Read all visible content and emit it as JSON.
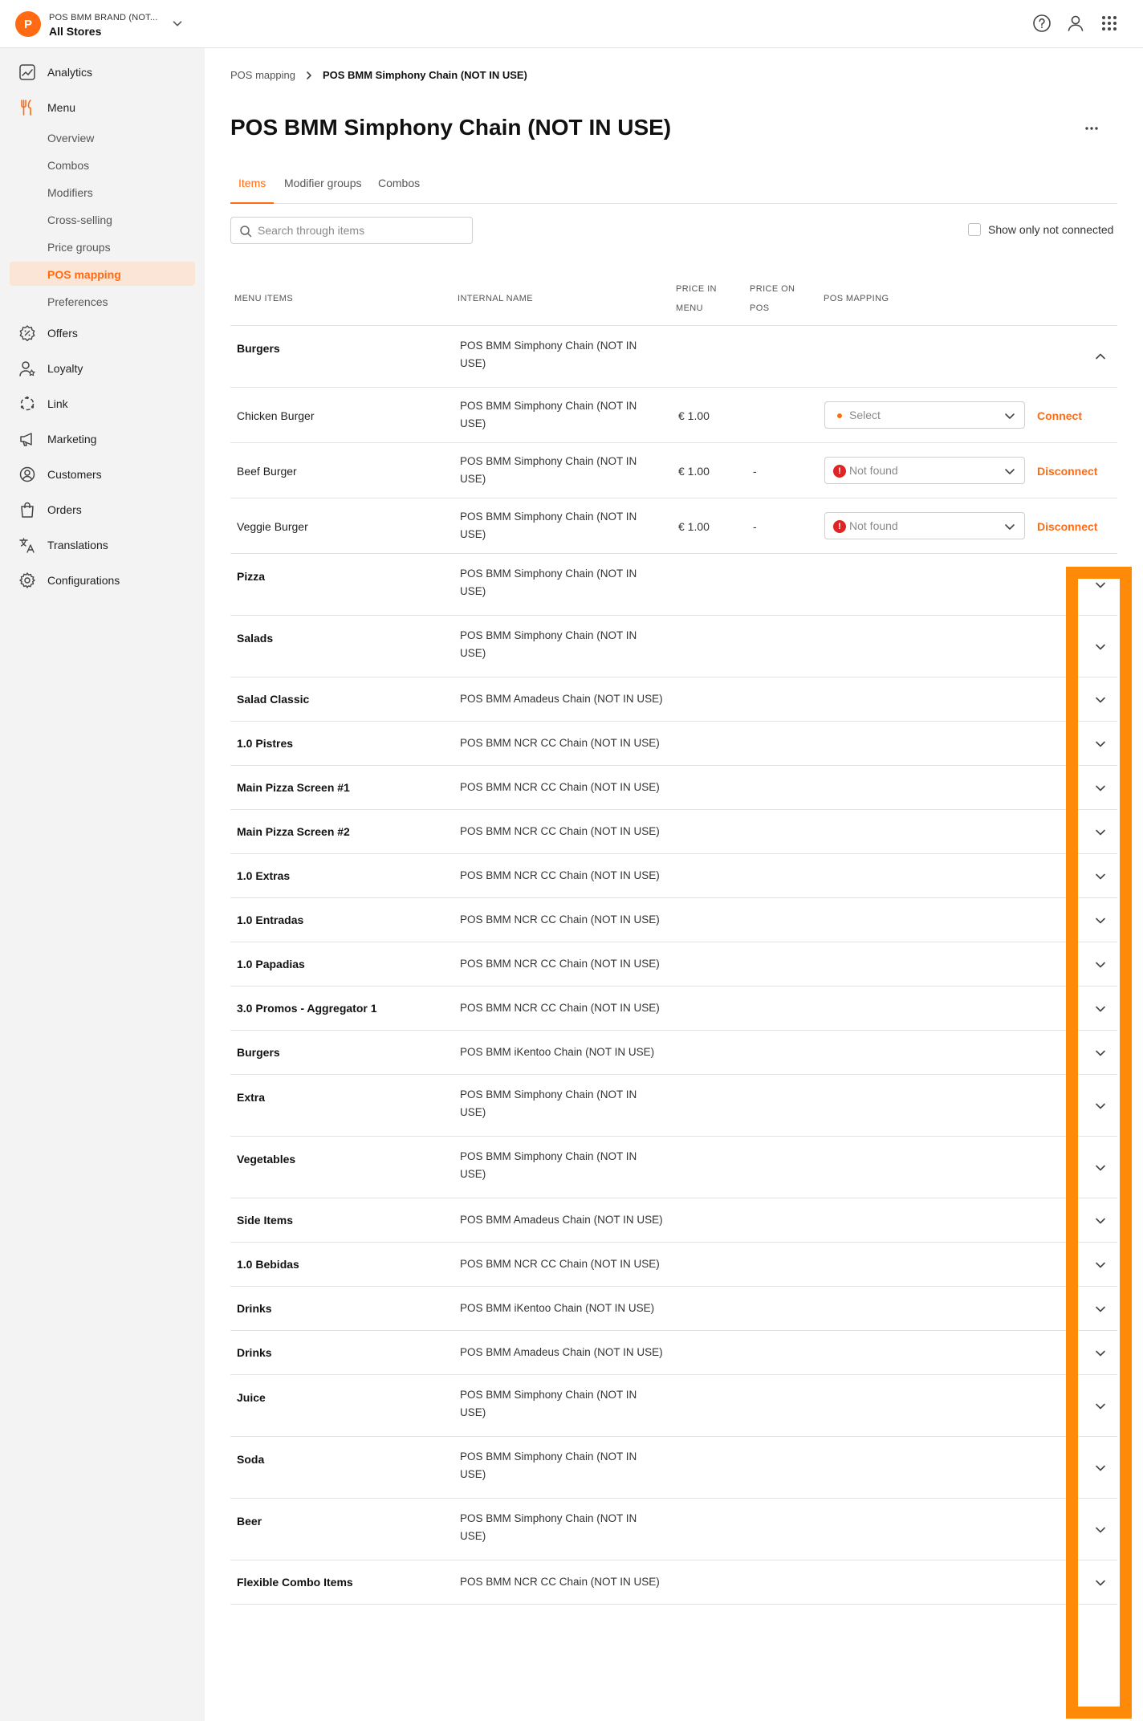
{
  "header": {
    "brand_initial": "P",
    "brand_name": "POS BMM BRAND (NOT...",
    "store": "All Stores"
  },
  "sidebar": {
    "items": [
      {
        "label": "Analytics",
        "icon": "analytics-icon"
      },
      {
        "label": "Menu",
        "icon": "menu-fork-icon"
      },
      {
        "label": "Offers",
        "icon": "offers-icon"
      },
      {
        "label": "Loyalty",
        "icon": "loyalty-icon"
      },
      {
        "label": "Link",
        "icon": "link-icon"
      },
      {
        "label": "Marketing",
        "icon": "megaphone-icon"
      },
      {
        "label": "Customers",
        "icon": "customers-icon"
      },
      {
        "label": "Orders",
        "icon": "bag-icon"
      },
      {
        "label": "Translations",
        "icon": "translate-icon"
      },
      {
        "label": "Configurations",
        "icon": "gear-icon"
      }
    ],
    "menu_subitems": [
      "Overview",
      "Combos",
      "Modifiers",
      "Cross-selling",
      "Price groups",
      "POS mapping",
      "Preferences"
    ],
    "active_subitem": "POS mapping"
  },
  "breadcrumb": {
    "parent": "POS mapping",
    "current": "POS BMM Simphony Chain (NOT IN USE)"
  },
  "page": {
    "title": "POS BMM Simphony Chain (NOT IN USE)"
  },
  "tabs": [
    "Items",
    "Modifier groups",
    "Combos"
  ],
  "active_tab": "Items",
  "search": {
    "placeholder": "Search through items",
    "value": ""
  },
  "filter": {
    "label": "Show only not connected",
    "checked": false
  },
  "table": {
    "headers": {
      "menu_items": "MENU ITEMS",
      "internal_name": "INTERNAL NAME",
      "price_in_menu_1": "PRICE IN",
      "price_in_menu_2": "MENU",
      "price_on_pos_1": "PRICE ON",
      "price_on_pos_2": "POS",
      "pos_mapping": "POS MAPPING"
    },
    "expanded_group": {
      "name": "Burgers",
      "internal": "POS BMM Simphony Chain (NOT IN USE)",
      "items": [
        {
          "name": "Chicken Burger",
          "internal": "POS BMM Simphony Chain (NOT IN USE)",
          "price_menu": "€ 1.00",
          "price_pos": "-",
          "mapping": "Select",
          "mapping_state": "select",
          "action": "Connect"
        },
        {
          "name": "Beef Burger",
          "internal": "POS BMM Simphony Chain (NOT IN USE)",
          "price_menu": "€ 1.00",
          "price_pos": "-",
          "mapping": "Not found",
          "mapping_state": "not-found",
          "action": "Disconnect"
        },
        {
          "name": "Veggie Burger",
          "internal": "POS BMM Simphony Chain (NOT IN USE)",
          "price_menu": "€ 1.00",
          "price_pos": "-",
          "mapping": "Not found",
          "mapping_state": "not-found",
          "action": "Disconnect"
        }
      ]
    },
    "groups": [
      {
        "name": "Pizza",
        "internal": "POS BMM Simphony Chain (NOT IN USE)"
      },
      {
        "name": "Salads",
        "internal": "POS BMM Simphony Chain (NOT IN USE)"
      },
      {
        "name": "Salad Classic",
        "internal": "POS BMM Amadeus Chain (NOT IN USE)"
      },
      {
        "name": "1.0 Pistres",
        "internal": "POS BMM NCR CC Chain (NOT IN USE)"
      },
      {
        "name": "Main Pizza Screen #1",
        "internal": "POS BMM NCR CC Chain (NOT IN USE)"
      },
      {
        "name": "Main Pizza Screen #2",
        "internal": "POS BMM NCR CC Chain (NOT IN USE)"
      },
      {
        "name": "1.0 Extras",
        "internal": "POS BMM NCR CC Chain (NOT IN USE)"
      },
      {
        "name": "1.0 Entradas",
        "internal": "POS BMM NCR CC Chain (NOT IN USE)"
      },
      {
        "name": "1.0 Papadias",
        "internal": "POS BMM NCR CC Chain (NOT IN USE)"
      },
      {
        "name": "3.0 Promos - Aggregator 1",
        "internal": "POS BMM NCR CC Chain (NOT IN USE)"
      },
      {
        "name": "Burgers",
        "internal": "POS BMM iKentoo Chain (NOT IN USE)"
      },
      {
        "name": "Extra",
        "internal": "POS BMM Simphony Chain (NOT IN USE)"
      },
      {
        "name": "Vegetables",
        "internal": "POS BMM Simphony Chain (NOT IN USE)"
      },
      {
        "name": "Side Items",
        "internal": "POS BMM Amadeus Chain (NOT IN USE)"
      },
      {
        "name": "1.0 Bebidas",
        "internal": "POS BMM NCR CC Chain (NOT IN USE)"
      },
      {
        "name": "Drinks",
        "internal": "POS BMM iKentoo Chain (NOT IN USE)"
      },
      {
        "name": "Drinks",
        "internal": "POS BMM Amadeus Chain (NOT IN USE)"
      },
      {
        "name": "Juice",
        "internal": "POS BMM Simphony Chain (NOT IN USE)"
      },
      {
        "name": "Soda",
        "internal": "POS BMM Simphony Chain (NOT IN USE)"
      },
      {
        "name": "Beer",
        "internal": "POS BMM Simphony Chain (NOT IN USE)"
      },
      {
        "name": "Flexible Combo Items",
        "internal": "POS BMM NCR CC Chain (NOT IN USE)"
      }
    ]
  },
  "colors": {
    "accent": "#ff6a13",
    "danger": "#e02424",
    "highlight": "#ff8a0a",
    "sidebar_bg": "#f3f3f3",
    "active_bg": "#fbe5d6"
  }
}
